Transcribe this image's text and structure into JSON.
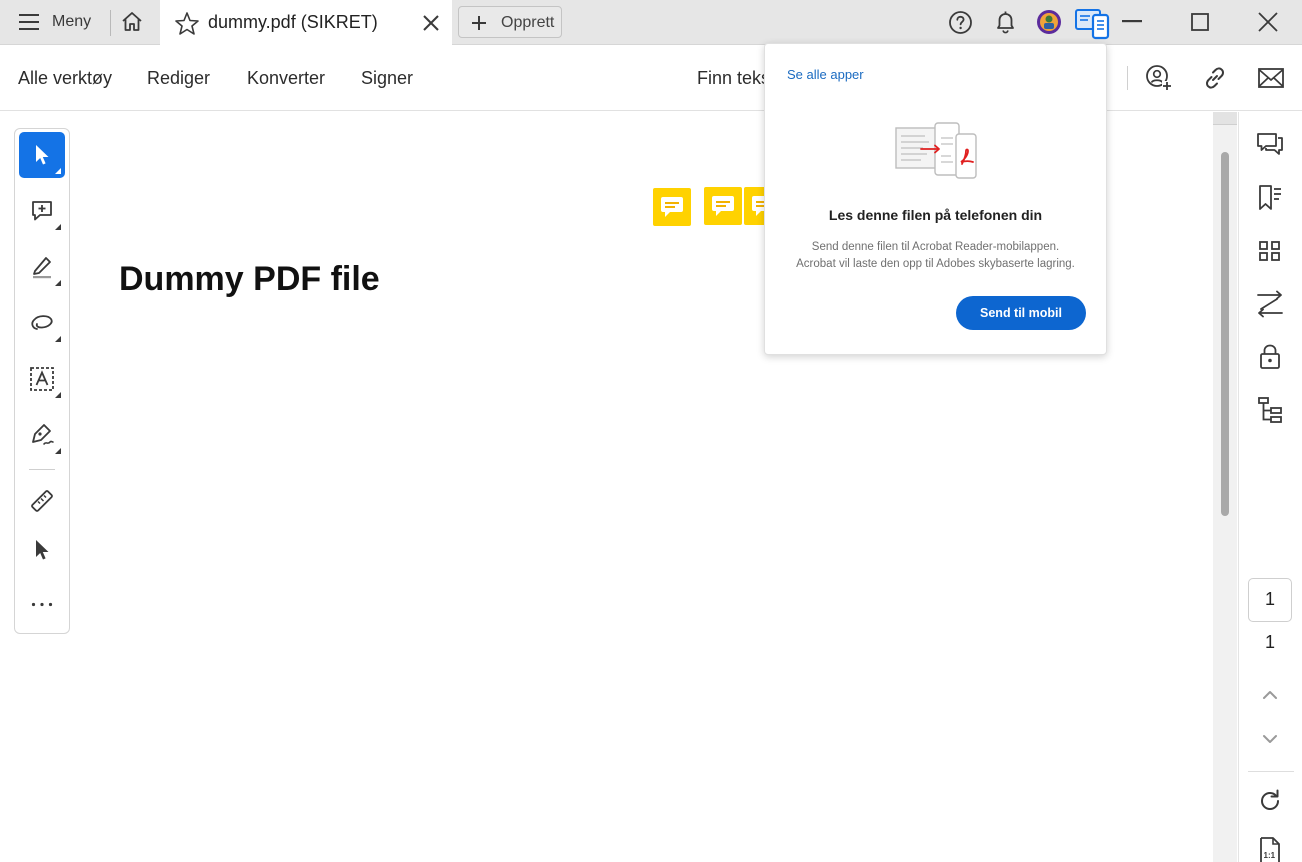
{
  "titlebar": {
    "menu_label": "Meny",
    "tab_title": "dummy.pdf (SIKRET)",
    "create_label": "Opprett"
  },
  "toolbar": {
    "all_tools": "Alle verktøy",
    "edit": "Rediger",
    "convert": "Konverter",
    "sign": "Signer",
    "find_text": "Finn teks"
  },
  "document": {
    "heading": "Dummy PDF file"
  },
  "popup": {
    "see_all_apps": "Se alle apper",
    "title": "Les denne filen på telefonen din",
    "description_line1": "Send denne filen til Acrobat Reader-mobilappen.",
    "description_line2": "Acrobat vil laste den opp til Adobes skybaserte lagring.",
    "send_button": "Send til mobil"
  },
  "pagination": {
    "current_page": "1",
    "total_pages": "1"
  },
  "zoom_icon_text": "1:1",
  "colors": {
    "accent": "#1473e6",
    "popup_button": "#0d66d0",
    "note_yellow": "#ffd200",
    "link": "#1b6bc1"
  }
}
